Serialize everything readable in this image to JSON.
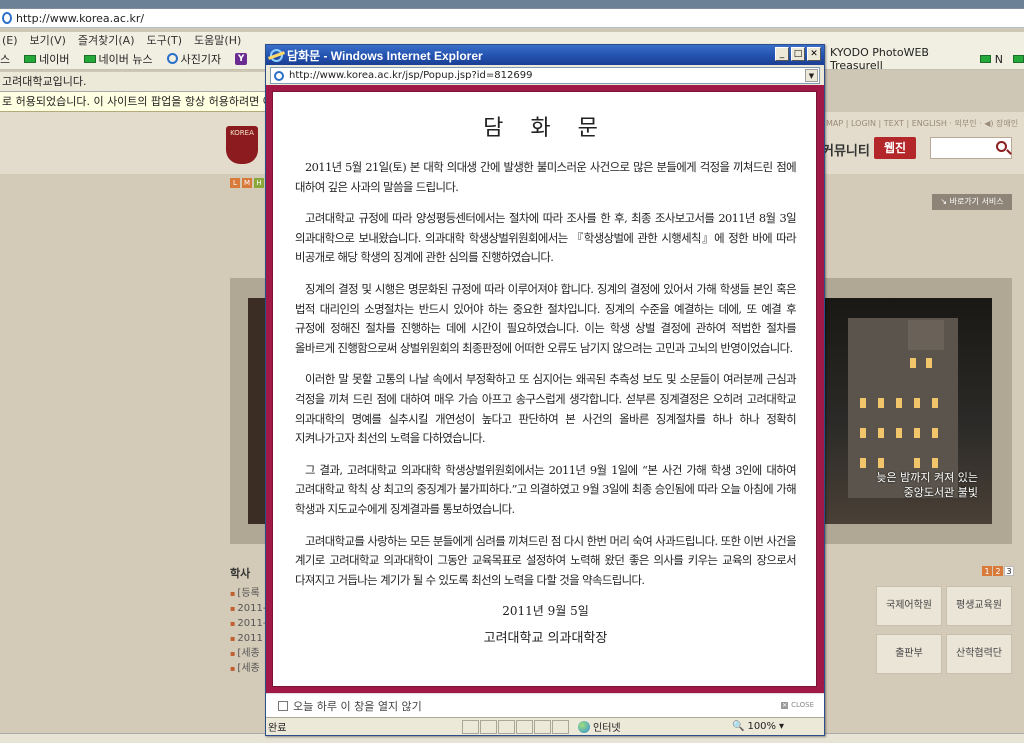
{
  "background_browser": {
    "address_url": "http://www.korea.ac.kr/",
    "menu": [
      "(E)",
      "보기(V)",
      "즐겨찾기(A)",
      "도구(T)",
      "도움말(H)"
    ],
    "favorites": [
      "스",
      "네이버",
      "네이버 뉴스",
      "사진기자"
    ],
    "favorites_right": [
      "KYODO PhotoWEB Treasurell",
      "N"
    ],
    "tab_title": "고려대학교입니다.",
    "popup_notice": "로 허용되었습니다. 이 사이트의 팝업을 항상 허용하려면 여",
    "site": {
      "util_links": "MAP | LOGIN | TEXT | ENGLISH · 외부인 · ◀) 장애인",
      "community": "커뮤니티",
      "webmail": "웹진",
      "shortcut": "↘ 바로가기 서비스",
      "lmh": [
        "L",
        "M",
        "H"
      ],
      "photo_caption_1": "늦은 밤까지 켜져 있는",
      "photo_caption_2": "중앙도서관 불빛",
      "news_title": "학사",
      "news_items": [
        "[등록",
        "2011-",
        "2011-",
        "2011",
        "[세종",
        "[세종"
      ],
      "pager": [
        "1",
        "2",
        "3"
      ],
      "boxes": [
        "국제어학원",
        "평생교육원",
        "출판부",
        "산학협력단"
      ]
    }
  },
  "popup": {
    "window_title": "담화문 - Windows Internet Explorer",
    "url": "http://www.korea.ac.kr/jsp/Popup.jsp?id=812699",
    "letter": {
      "title": "담 화 문",
      "paragraphs": [
        "2011년 5월 21일(토) 본 대학 의대생 간에 발생한 불미스러운 사건으로 많은 분들에게 걱정을 끼쳐드린 점에 대하여 깊은 사과의 말씀을 드립니다.",
        "고려대학교 규정에 따라 양성평등센터에서는 절차에 따라 조사를 한 후, 최종 조사보고서를 2011년 8월 3일 의과대학으로 보내왔습니다. 의과대학 학생상벌위원회에서는 『학생상벌에 관한 시행세칙』에 정한 바에 따라 비공개로 해당 학생의 징계에 관한 심의를 진행하였습니다.",
        "징계의 결정 및 시행은 명문화된 규정에 따라 이루어져야 합니다. 징계의 결정에 있어서 가해 학생들 본인 혹은 법적 대리인의 소명절차는 반드시 있어야 하는 중요한 절차입니다. 징계의 수준을 예결하는 데에, 또 예결 후 규정에 정해진 절차를 진행하는 데에 시간이 필요하였습니다. 이는 학생 상벌 결정에 관하여 적법한 절차를 올바르게 진행함으로써 상벌위원회의 최종판정에 어떠한 오류도 남기지 않으려는 고민과 고뇌의 반영이었습니다.",
        "이러한 말 못할 고통의 나날 속에서 부정확하고 또 심지어는 왜곡된 추측성 보도 및 소문들이 여러분께 근심과 걱정을 끼쳐 드린 점에 대하여 매우 가슴 아프고 송구스럽게 생각합니다. 섣부른 징계결정은 오히려 고려대학교 의과대학의 명예를 실추시킬 개연성이 높다고 판단하여 본 사건의 올바른 징계절차를 하나 하나 정확히 지켜나가고자 최선의 노력을 다하였습니다.",
        "그 결과, 고려대학교 의과대학 학생상벌위원회에서는 2011년 9월 1일에 “본 사건 가해 학생 3인에 대하여 고려대학교 학칙 상 최고의 중징계가 불가피하다.”고 의결하였고 9월 3일에 최종 승인됨에 따라 오늘 아침에 가해 학생과 지도교수에게 징계결과를 통보하였습니다.",
        "고려대학교를 사랑하는 모든 분들에게 심려를 끼쳐드린 점 다시 한번 머리 숙여 사과드립니다. 또한 이번 사건을 계기로 고려대학교 의과대학이 그동안 교육목표로 설정하여 노력해 왔던 좋은 의사를 키우는 교육의 장으로서 다져지고 거듭나는 계기가 될 수 있도록 최선의 노력을 다할 것을 약속드립니다."
      ],
      "date": "2011년 9월 5일",
      "signature": "고려대학교 의과대학장"
    },
    "footer": {
      "checkbox_label": "오늘 하루 이 창을 열지 않기",
      "close_label": "CLOSE"
    },
    "status": {
      "text": "완료",
      "zone": "인터넷",
      "zoom": "100%"
    }
  }
}
